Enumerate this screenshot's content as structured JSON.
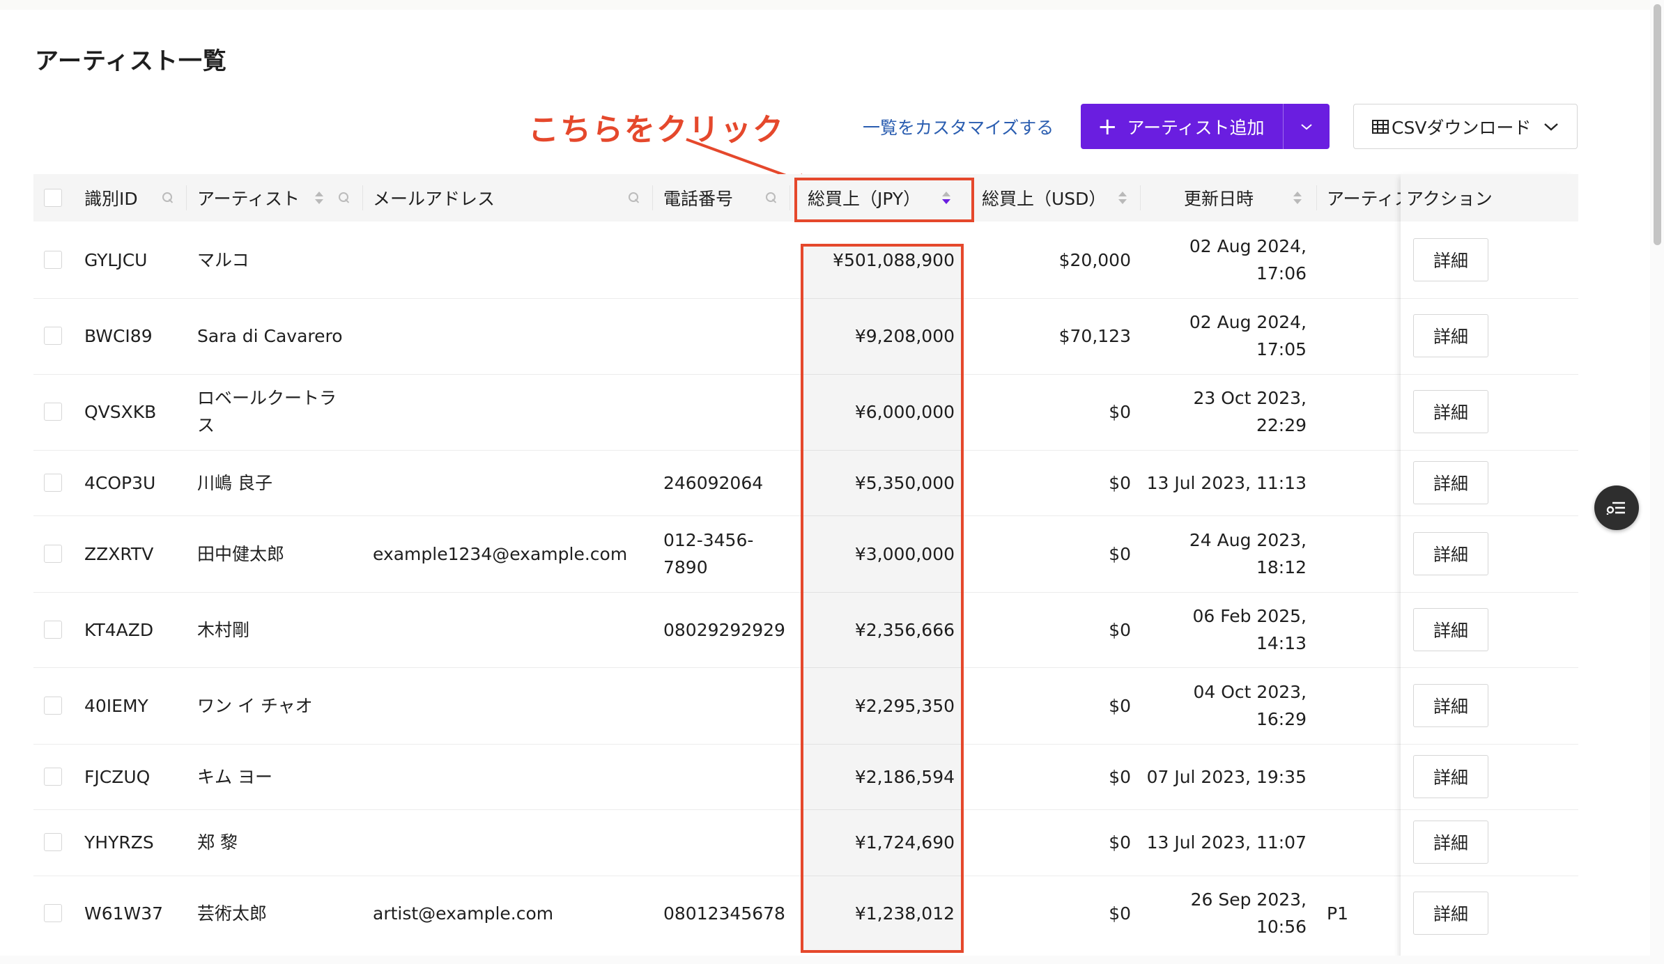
{
  "page": {
    "title": "アーティスト一覧"
  },
  "annotation": {
    "text": "こちらをクリック",
    "color": "#e5482c"
  },
  "toolbar": {
    "customize_link": "一覧をカスタマイズする",
    "add_button": {
      "icon": "plus-icon",
      "label": "アーティスト追加",
      "dropdown_icon": "chevron-down-icon"
    },
    "csv_button": {
      "icon": "table-icon",
      "label": "CSVダウンロード",
      "dropdown_icon": "chevron-down-icon"
    }
  },
  "colors": {
    "accent": "#6a1ee0",
    "link": "#2a5db0",
    "annotation": "#e5482c"
  },
  "table": {
    "columns": [
      {
        "label": "識別ID",
        "sortable": false,
        "searchable": true
      },
      {
        "label": "アーティスト",
        "sortable": true,
        "searchable": true
      },
      {
        "label": "メールアドレス",
        "sortable": false,
        "searchable": true
      },
      {
        "label": "電話番号",
        "sortable": false,
        "searchable": true
      },
      {
        "label": "総買上（JPY）",
        "sortable": true,
        "sort_direction": "descending"
      },
      {
        "label": "総買上（USD）",
        "sortable": true
      },
      {
        "label": "更新日時",
        "sortable": true
      },
      {
        "label": "アーティス",
        "sortable": false
      },
      {
        "label": "アクション",
        "sortable": false
      }
    ],
    "detail_label": "詳細",
    "rows": [
      {
        "id": "GYLJCU",
        "artist": [
          "マルコ"
        ],
        "email": "",
        "phone": [],
        "jpy": "¥501,088,900",
        "usd": "$20,000",
        "updated": [
          "02 Aug 2024,",
          "17:06"
        ],
        "extra": ""
      },
      {
        "id": "BWCI89",
        "artist": [
          "Sara di Cavarero"
        ],
        "email": "",
        "phone": [],
        "jpy": "¥9,208,000",
        "usd": "$70,123",
        "updated": [
          "02 Aug 2024,",
          "17:05"
        ],
        "extra": ""
      },
      {
        "id": "QVSXKB",
        "artist": [
          "ロベールクートラ",
          "ス"
        ],
        "email": "",
        "phone": [],
        "jpy": "¥6,000,000",
        "usd": "$0",
        "updated": [
          "23 Oct 2023,",
          "22:29"
        ],
        "extra": ""
      },
      {
        "id": "4COP3U",
        "artist": [
          "川嶋 良子"
        ],
        "email": "",
        "phone": [
          "246092064"
        ],
        "jpy": "¥5,350,000",
        "usd": "$0",
        "updated": [
          "13 Jul 2023, 11:13"
        ],
        "extra": ""
      },
      {
        "id": "ZZXRTV",
        "artist": [
          "田中健太郎"
        ],
        "email": "example1234@example.com",
        "phone": [
          "012-3456-",
          "7890"
        ],
        "jpy": "¥3,000,000",
        "usd": "$0",
        "updated": [
          "24 Aug 2023,",
          "18:12"
        ],
        "extra": ""
      },
      {
        "id": "KT4AZD",
        "artist": [
          "木村剛"
        ],
        "email": "",
        "phone": [
          "08029292929"
        ],
        "jpy": "¥2,356,666",
        "usd": "$0",
        "updated": [
          "06 Feb 2025,",
          "14:13"
        ],
        "extra": ""
      },
      {
        "id": "40IEMY",
        "artist": [
          "ワン イ チャオ"
        ],
        "email": "",
        "phone": [],
        "jpy": "¥2,295,350",
        "usd": "$0",
        "updated": [
          "04 Oct 2023,",
          "16:29"
        ],
        "extra": ""
      },
      {
        "id": "FJCZUQ",
        "artist": [
          "キム ヨー"
        ],
        "email": "",
        "phone": [],
        "jpy": "¥2,186,594",
        "usd": "$0",
        "updated": [
          "07 Jul 2023, 19:35"
        ],
        "extra": ""
      },
      {
        "id": "YHYRZS",
        "artist": [
          "郑 黎"
        ],
        "email": "",
        "phone": [],
        "jpy": "¥1,724,690",
        "usd": "$0",
        "updated": [
          "13 Jul 2023, 11:07"
        ],
        "extra": ""
      },
      {
        "id": "W61W37",
        "artist": [
          "芸術太郎"
        ],
        "email": "artist@example.com",
        "phone": [
          "08012345678"
        ],
        "jpy": "¥1,238,012",
        "usd": "$0",
        "updated": [
          "26 Sep 2023,",
          "10:56"
        ],
        "extra": "P1"
      }
    ]
  },
  "floating_button": {
    "icon": "filter-list-icon"
  }
}
